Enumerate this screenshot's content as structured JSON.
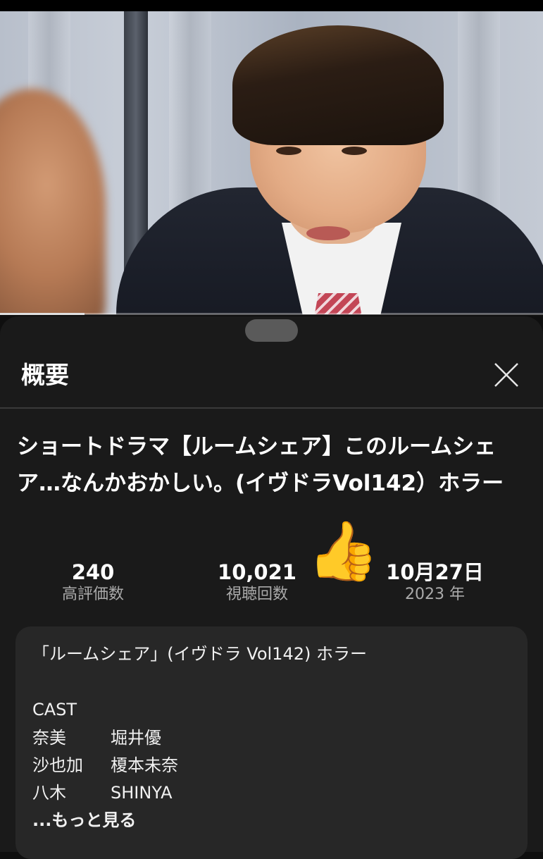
{
  "video": {
    "progress_fraction": 0.155
  },
  "panel": {
    "title": "概要",
    "close_icon": "close-icon"
  },
  "video_title": "ショートドラマ【ルームシェア】このルームシェア…なんかおかしい。(イヴドラVol142）ホラー",
  "stats": {
    "likes": {
      "value": "240",
      "label": "高評価数"
    },
    "views": {
      "value": "10,021",
      "label": "視聴回数"
    },
    "date": {
      "value": "10月27日",
      "label": "2023 年"
    }
  },
  "overlay": {
    "thumbs_up": "👍"
  },
  "description": {
    "heading": "「ルームシェア」(イヴドラ Vol142) ホラー",
    "cast_label": "CAST",
    "cast": [
      {
        "role": "奈美",
        "actor": "堀井優"
      },
      {
        "role": "沙也加",
        "actor": "榎本未奈"
      },
      {
        "role": "八木",
        "actor": "SHINYA"
      }
    ],
    "more": "...もっと見る"
  },
  "colors": {
    "background": "#0f0f0f",
    "sheet": "#1a1a1a",
    "description_box": "#272727",
    "secondary_text": "#aaaaaa"
  }
}
